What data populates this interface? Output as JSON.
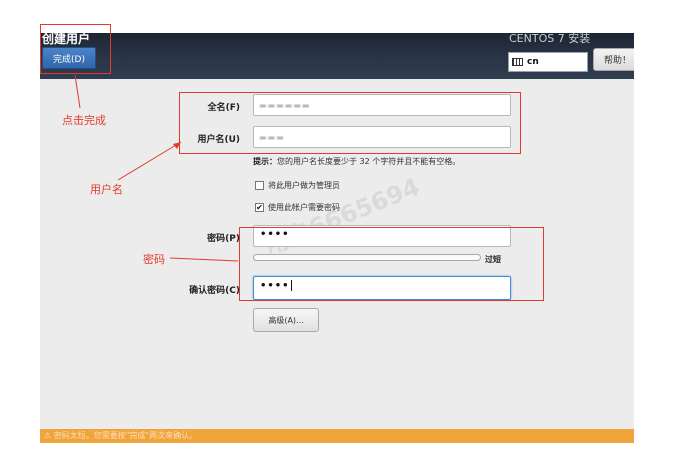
{
  "header": {
    "title": "创建用户",
    "done_label": "完成(D)",
    "product": "CENTOS 7 安装",
    "keyboard_layout": "cn",
    "help_label": "帮助！"
  },
  "form": {
    "fullname_label": "全名(F)",
    "username_label": "用户名(U)",
    "hint_prefix": "提示：",
    "hint_text": "您的用户名长度要少于 32 个字符并且不能有空格。",
    "admin_checkbox_label": "将此用户做为管理员",
    "admin_checked": false,
    "require_password_label": "使用此帐户需要密码",
    "require_password_checked": true,
    "password_label": "密码(P)",
    "password_value": "••••",
    "strength_label": "过短",
    "strength_fraction": 0.0,
    "confirm_label": "确认密码(C)",
    "confirm_value": "••••",
    "advanced_label": "高级(A)..."
  },
  "warning_bar": {
    "text": "密码太短。您需要按\"完成\"两次来确认。"
  },
  "watermark": "用户6665694",
  "annotations": {
    "click_done": "点击完成",
    "username": "用户名",
    "password": "密码"
  },
  "colors": {
    "annotation_red": "#e23b2a",
    "topbar": "#1d2533",
    "done_button": "#3a73bb",
    "warning_bar": "#f0a43a"
  }
}
